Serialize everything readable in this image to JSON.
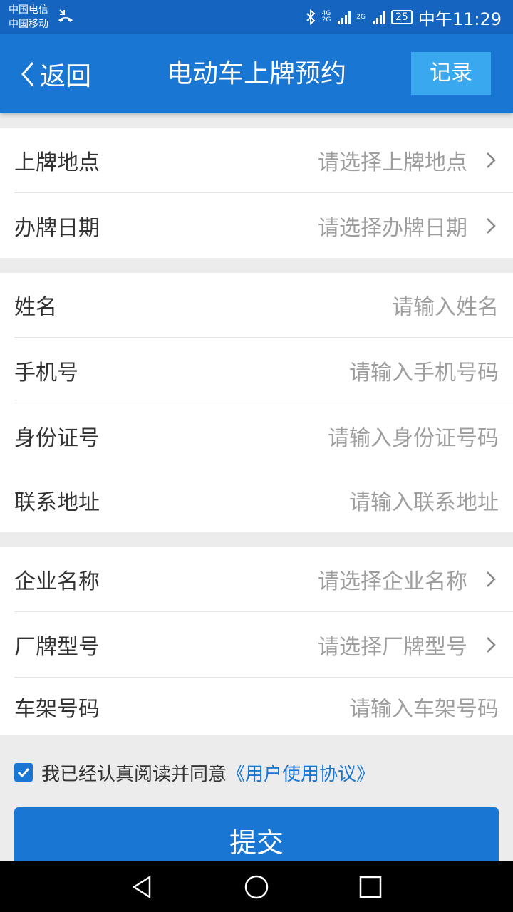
{
  "status_bar": {
    "carrier_1": "中国电信",
    "carrier_2": "中国移动",
    "network_1": "4G",
    "network_2": "2G",
    "network_3": "2G",
    "battery": "25",
    "time": "中午11:29"
  },
  "header": {
    "back_label": "返回",
    "title": "电动车上牌预约",
    "record_button": "记录"
  },
  "groups": [
    {
      "rows": [
        {
          "label": "上牌地点",
          "value": "请选择上牌地点",
          "type": "select"
        },
        {
          "label": "办牌日期",
          "value": "请选择办牌日期",
          "type": "select"
        }
      ]
    },
    {
      "rows": [
        {
          "label": "姓名",
          "value": "请输入姓名",
          "type": "input"
        },
        {
          "label": "手机号",
          "value": "请输入手机号码",
          "type": "input"
        },
        {
          "label": "身份证号",
          "value": "请输入身份证号码",
          "type": "input"
        },
        {
          "label": "联系地址",
          "value": "请输入联系地址",
          "type": "input"
        }
      ]
    },
    {
      "rows": [
        {
          "label": "企业名称",
          "value": "请选择企业名称",
          "type": "select"
        },
        {
          "label": "厂牌型号",
          "value": "请选择厂牌型号",
          "type": "select"
        },
        {
          "label": "车架号码",
          "value": "请输入车架号码",
          "type": "input"
        }
      ]
    }
  ],
  "agreement": {
    "checked": true,
    "text": "我已经认真阅读并同意",
    "link": "《用户使用协议》"
  },
  "submit_label": "提交",
  "colors": {
    "primary": "#1976d2",
    "status_bar": "#1565c0",
    "record_button": "#3aa8ee",
    "background": "#ececec",
    "label": "#333333",
    "placeholder": "#9e9e9e"
  },
  "icons": [
    "back-chevron-icon",
    "right-chevron-icon",
    "checkbox-checked-icon",
    "bluetooth-icon",
    "signal-icon",
    "battery-icon",
    "nav-back-icon",
    "nav-home-icon",
    "nav-recents-icon"
  ]
}
